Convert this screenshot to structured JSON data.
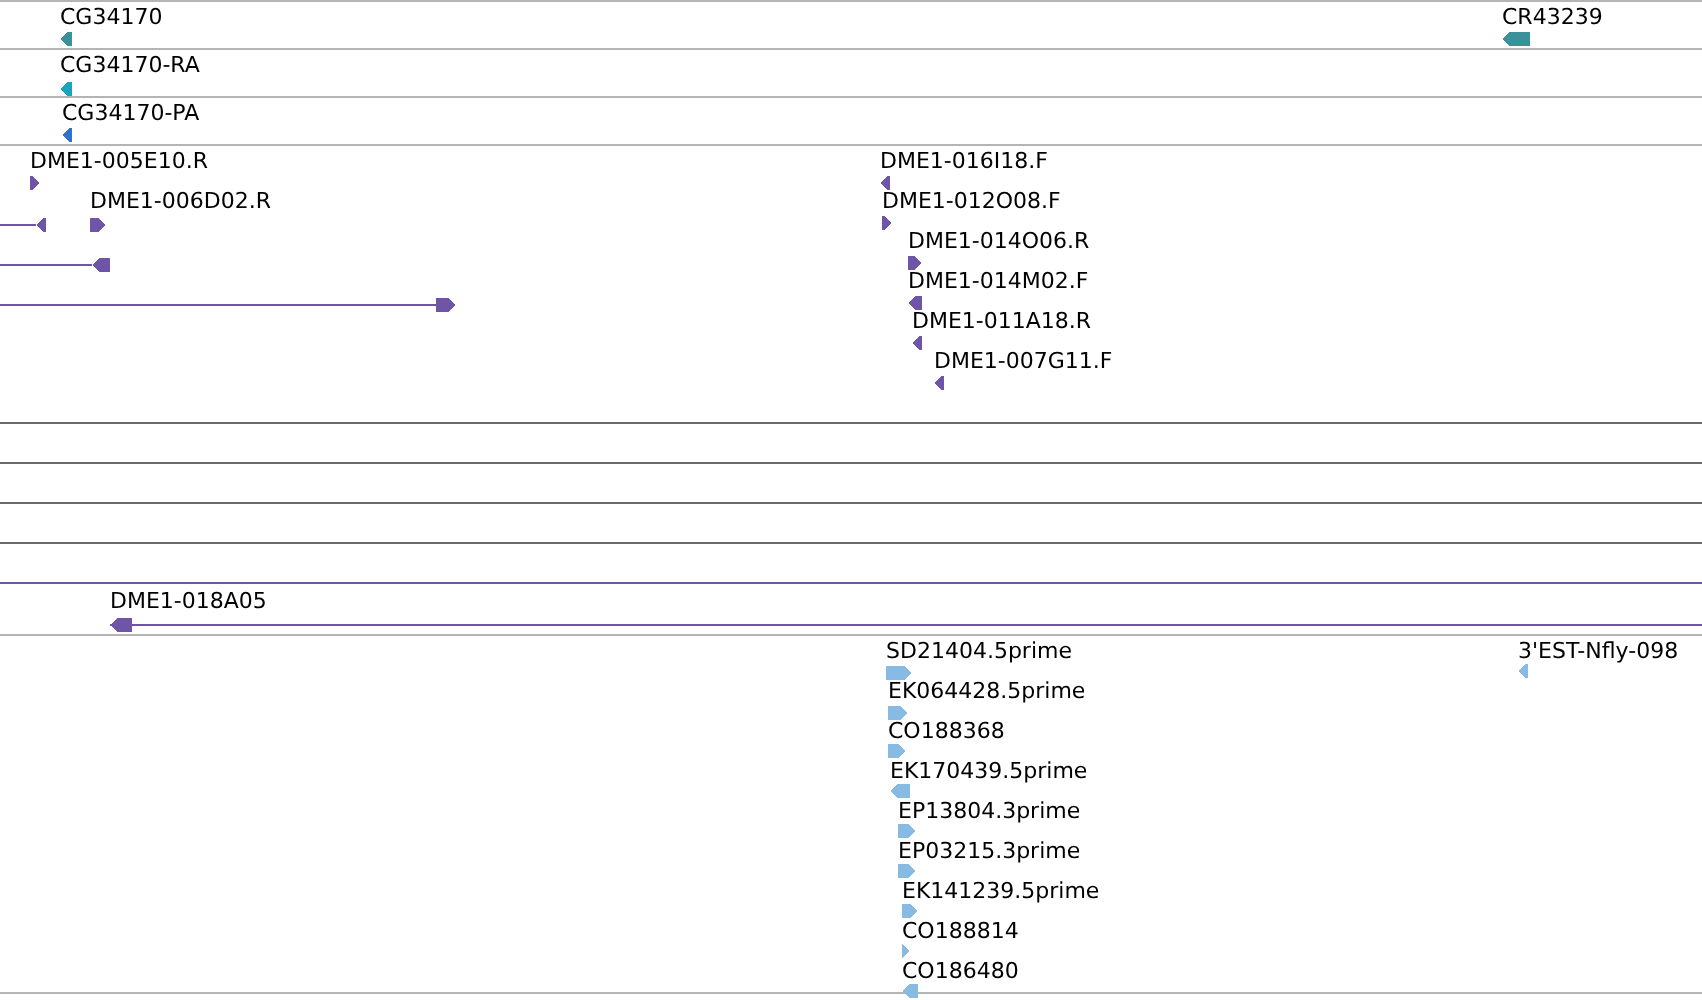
{
  "tracks": [
    {
      "color": "#3a9199",
      "features": [
        {
          "label": "CG34170",
          "kind": "reverse"
        },
        {
          "label": "CR43239",
          "kind": "reverse"
        }
      ]
    },
    {
      "color": "#1aa3bd",
      "features": [
        {
          "label": "CG34170-RA",
          "kind": "reverse"
        }
      ]
    },
    {
      "color": "#3370cc",
      "features": [
        {
          "label": "CG34170-PA",
          "kind": "reverse"
        }
      ]
    },
    {
      "color": "#6e55a8",
      "features": [
        {
          "label": "DME1-005E10.R",
          "kind": "forward"
        },
        {
          "kind": "reverse"
        },
        {
          "label": "DME1-006D02.R",
          "kind": "forward"
        },
        {
          "kind": "reverse"
        },
        {
          "kind": "forward"
        },
        {
          "label": "DME1-016I18.F",
          "kind": "reverse"
        },
        {
          "label": "DME1-012O08.F",
          "kind": "forward"
        },
        {
          "label": "DME1-014O06.R",
          "kind": "forward"
        },
        {
          "label": "DME1-014M02.F",
          "kind": "reverse"
        },
        {
          "label": "DME1-011A18.R",
          "kind": "reverse"
        },
        {
          "label": "DME1-007G11.F",
          "kind": "reverse"
        }
      ]
    },
    {
      "color": "#6e55a8",
      "features": [
        {
          "label": "DME1-018A05",
          "kind": "reverse"
        }
      ]
    },
    {
      "color": "#88bbe3",
      "features": [
        {
          "label": "SD21404.5prime",
          "kind": "forward"
        },
        {
          "label": "EK064428.5prime",
          "kind": "forward"
        },
        {
          "label": "CO188368",
          "kind": "forward"
        },
        {
          "label": "EK170439.5prime",
          "kind": "reverse"
        },
        {
          "label": "EP13804.3prime",
          "kind": "forward"
        },
        {
          "label": "EP03215.3prime",
          "kind": "forward"
        },
        {
          "label": "EK141239.5prime",
          "kind": "forward"
        },
        {
          "label": "CO188814",
          "kind": "forward"
        },
        {
          "label": "CO186480",
          "kind": "reverse"
        },
        {
          "label": "3'EST-Nfly-098",
          "kind": "reverse"
        }
      ]
    }
  ]
}
